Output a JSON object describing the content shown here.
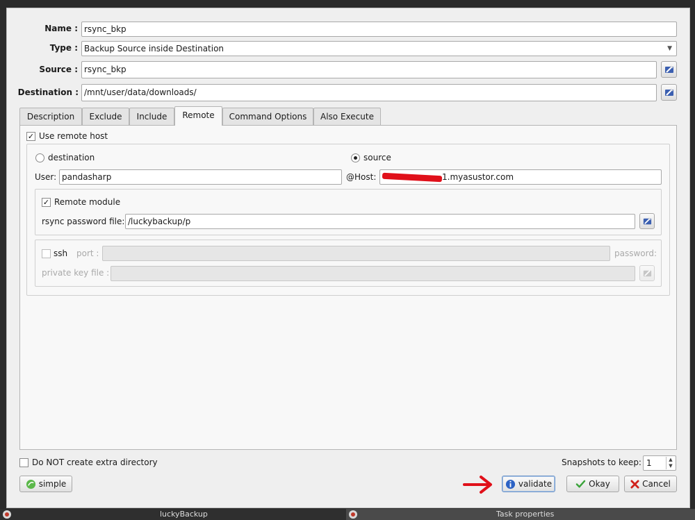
{
  "form": {
    "name_label": "Name :",
    "name_value": "rsync_bkp",
    "type_label": "Type :",
    "type_value": "Backup Source inside Destination",
    "source_label": "Source :",
    "source_value": "rsync_bkp",
    "destination_label": "Destination :",
    "destination_value": "/mnt/user/data/downloads/"
  },
  "tabs": [
    {
      "label": "Description"
    },
    {
      "label": "Exclude"
    },
    {
      "label": "Include"
    },
    {
      "label": "Remote"
    },
    {
      "label": "Command Options"
    },
    {
      "label": "Also Execute"
    }
  ],
  "active_tab": "Remote",
  "remote": {
    "use_remote_host_label": "Use remote host",
    "use_remote_host_checked": true,
    "destination_radio_label": "destination",
    "source_radio_label": "source",
    "selected_radio": "source",
    "user_label": "User:",
    "user_value": "pandasharp",
    "host_label": "@Host:",
    "host_value_visible": "1.myasustor.com",
    "remote_module_label": "Remote module",
    "remote_module_checked": true,
    "rsync_password_file_label": "rsync password file:",
    "rsync_password_file_value": "/luckybackup/p",
    "ssh_label": "ssh",
    "ssh_checked": false,
    "port_label": "port :",
    "password_label": "password:",
    "private_key_file_label": "private key file :"
  },
  "footer": {
    "no_extra_dir_label": "Do NOT create extra directory",
    "snapshots_label": "Snapshots to keep:",
    "snapshots_value": "1",
    "simple_button": "simple",
    "validate_button": "validate",
    "okay_button": "Okay",
    "cancel_button": "Cancel"
  },
  "taskbar": {
    "app1": "luckyBackup",
    "app2": "Task properties"
  },
  "colors": {
    "annotation_arrow": "#e0101a",
    "redaction_mark": "#e0101a",
    "validate_icon": "#2c62c4",
    "okay_icon": "#3aa33a",
    "cancel_icon": "#d0201a"
  }
}
